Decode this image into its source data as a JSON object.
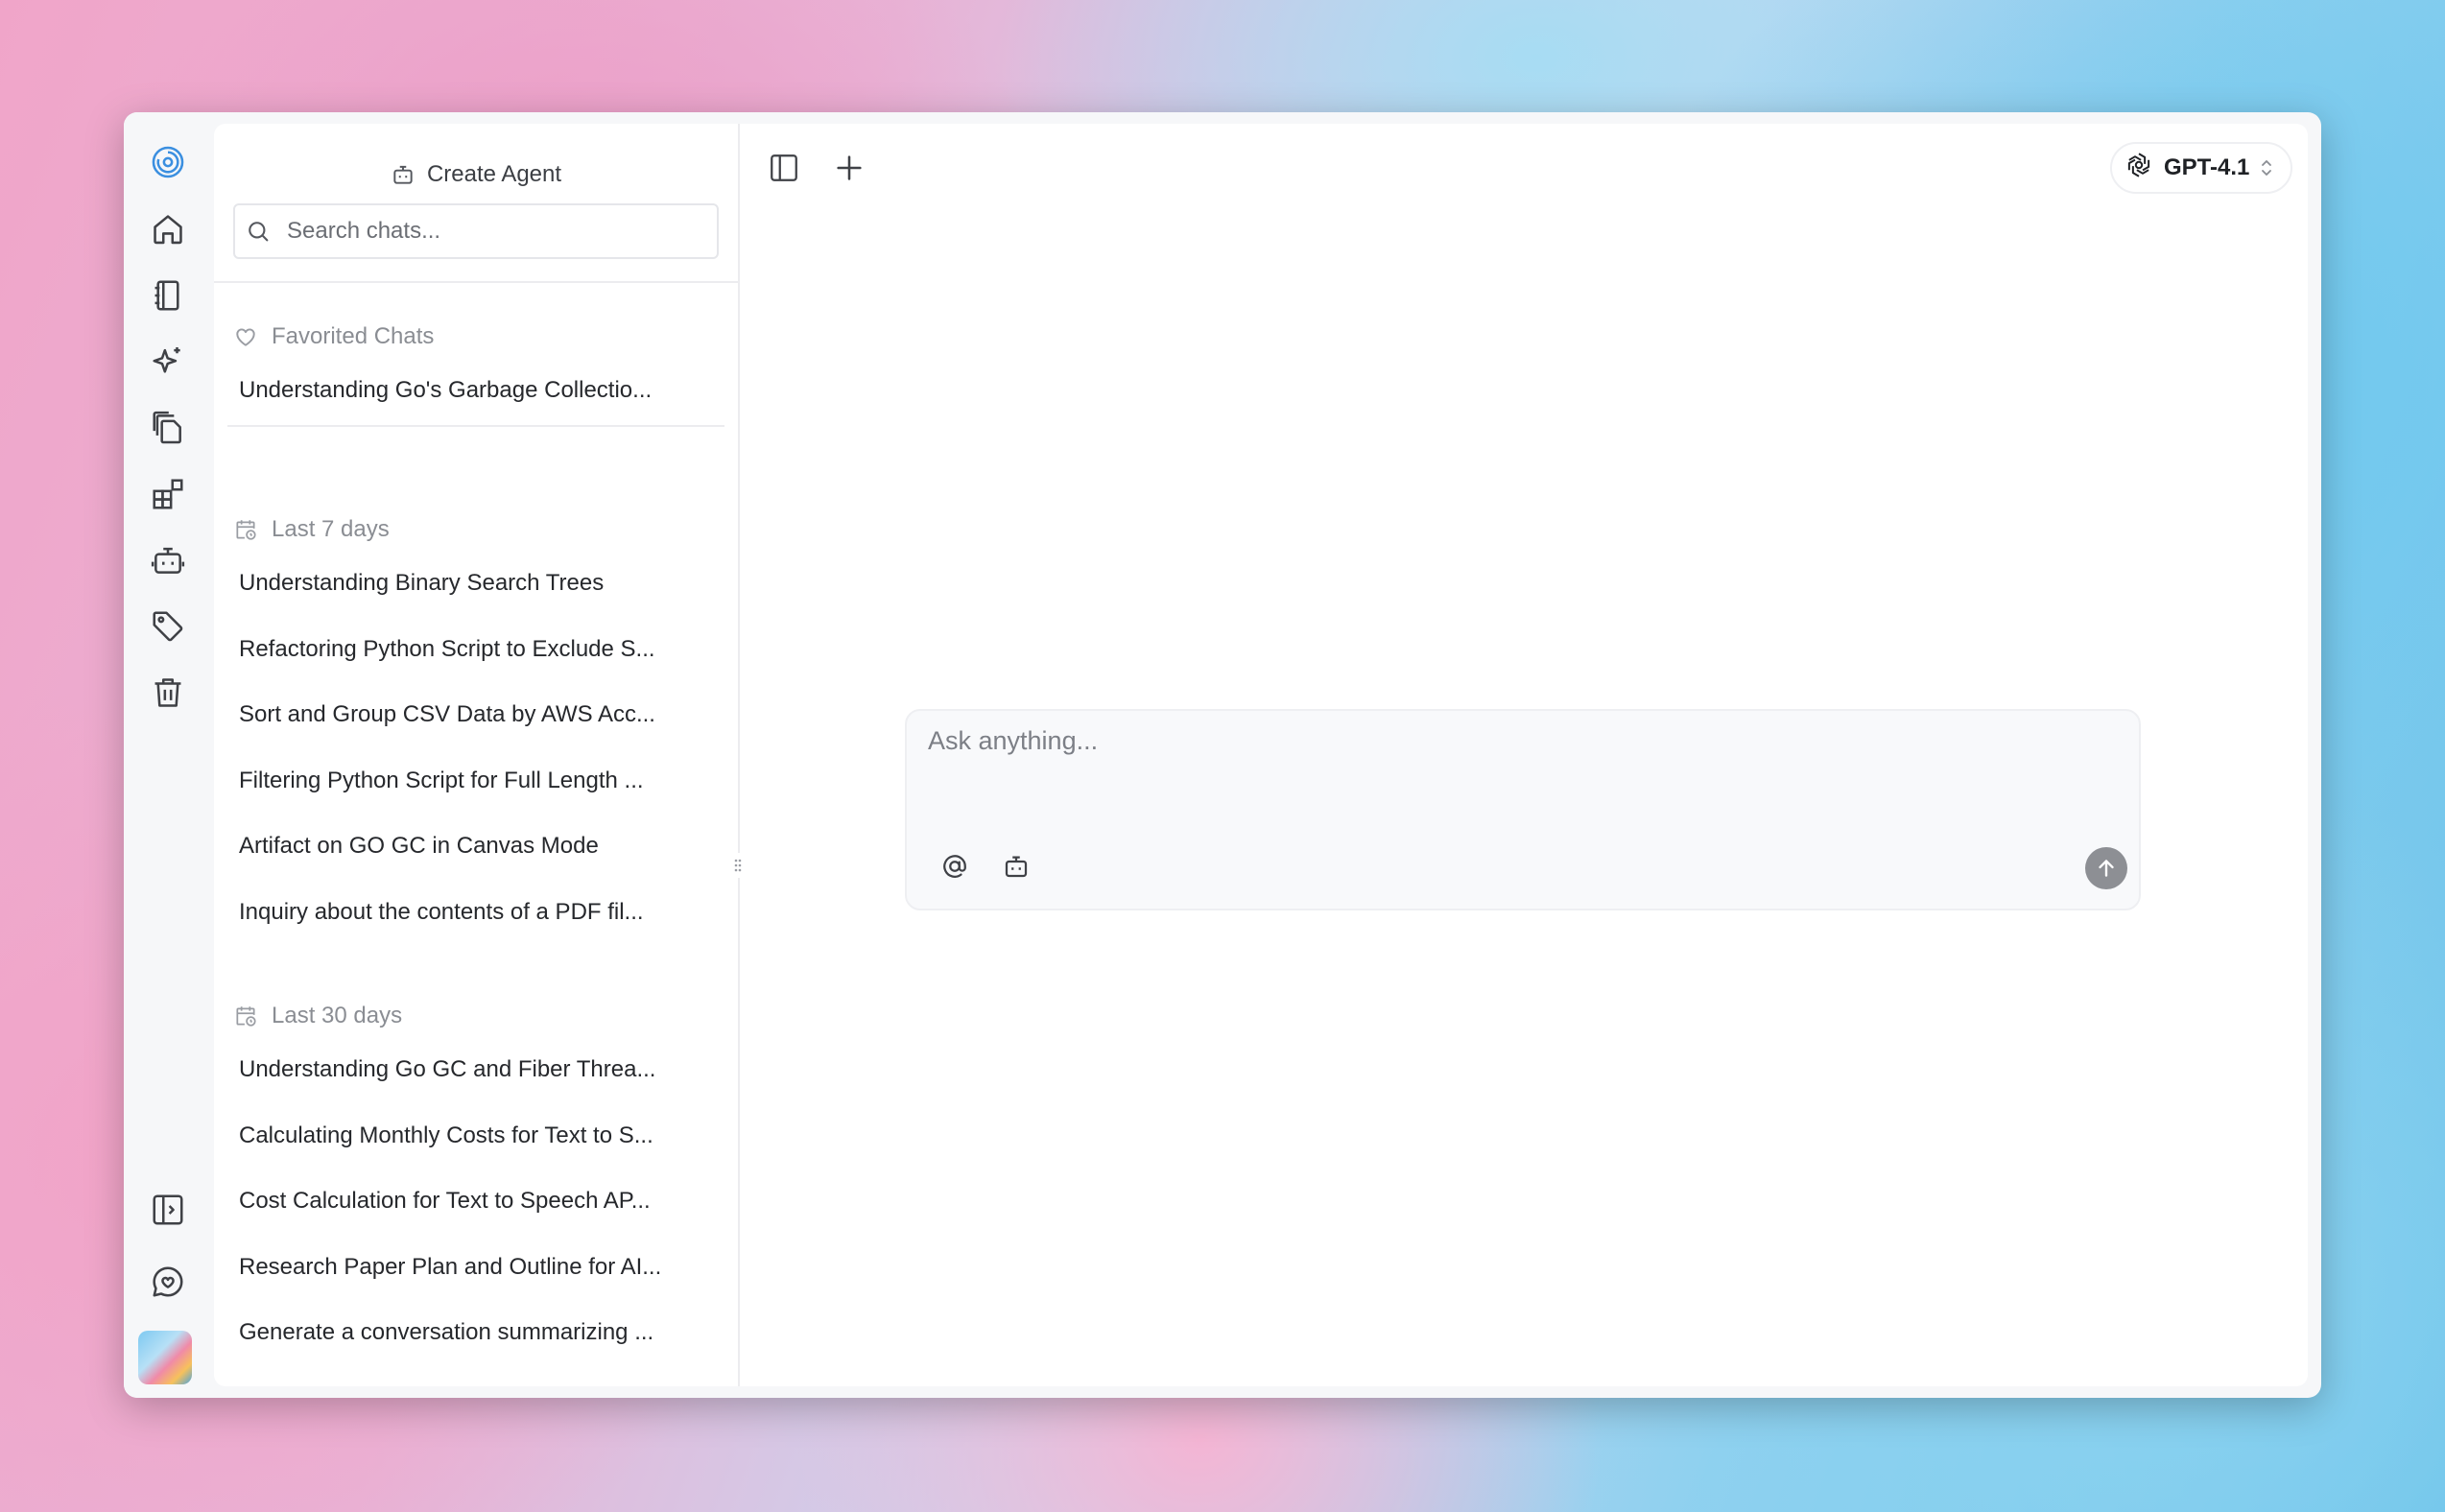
{
  "sidebar": {
    "create_agent_label": "Create Agent",
    "search_placeholder": "Search chats...",
    "favorited": {
      "label": "Favorited Chats",
      "items": [
        "Understanding Go's Garbage Collectio..."
      ]
    },
    "last7": {
      "label": "Last 7 days",
      "items": [
        "Understanding Binary Search Trees",
        "Refactoring Python Script to Exclude S...",
        "Sort and Group CSV Data by AWS Acc...",
        "Filtering Python Script for Full Length ...",
        "Artifact on GO GC in Canvas Mode",
        "Inquiry about the contents of a PDF fil..."
      ]
    },
    "last30": {
      "label": "Last 30 days",
      "items": [
        "Understanding Go GC and Fiber Threa...",
        "Calculating Monthly Costs for Text to S...",
        "Cost Calculation for Text to Speech AP...",
        "Research Paper Plan and Outline for AI...",
        "Generate a conversation summarizing ..."
      ]
    }
  },
  "header": {
    "model_name": "GPT-4.1"
  },
  "composer": {
    "placeholder": "Ask anything..."
  },
  "icons": {
    "rail": [
      "app-logo-icon",
      "home-icon",
      "notebook-icon",
      "sparkles-icon",
      "files-icon",
      "apps-icon",
      "bot-icon",
      "tag-icon",
      "trash-icon",
      "panel-expand-icon",
      "chat-heart-icon"
    ],
    "accent": "#3b8fe0"
  }
}
